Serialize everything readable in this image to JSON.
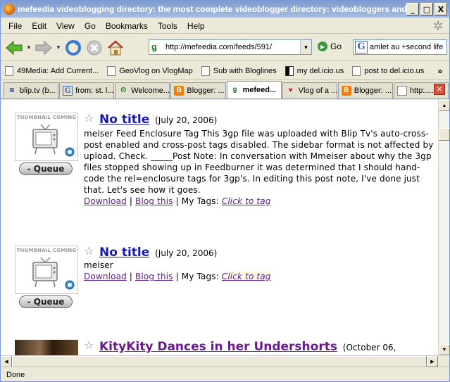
{
  "window": {
    "title": "mefeedia videoblogging directory: the most complete videoblogger directory: videobloggers and ...",
    "minimize": "_",
    "maximize": "□",
    "close": "X"
  },
  "menu": [
    {
      "label": "File",
      "key": "F"
    },
    {
      "label": "Edit",
      "key": "E"
    },
    {
      "label": "View",
      "key": "V"
    },
    {
      "label": "Go",
      "key": "G"
    },
    {
      "label": "Bookmarks",
      "key": "B"
    },
    {
      "label": "Tools",
      "key": "T"
    },
    {
      "label": "Help",
      "key": "H"
    }
  ],
  "navbar": {
    "url": "http://mefeedia.com/feeds/591/",
    "go_label": "Go",
    "search_value": "amlet au +second life"
  },
  "bookmarks": [
    {
      "label": "49Media: Add Current..."
    },
    {
      "label": "GeoVlog on VlogMap"
    },
    {
      "label": "Sub with Bloglines"
    },
    {
      "label": "my del.icio.us"
    },
    {
      "label": "post to del.icio.us"
    }
  ],
  "bookmarks_chevron": "»",
  "tabs": [
    {
      "label": "blip.tv (b...",
      "icon": "wifi-icon"
    },
    {
      "label": "from: st. l...",
      "icon": "google-icon"
    },
    {
      "label": "Welcome...",
      "icon": "tripadvisor-icon"
    },
    {
      "label": "Blogger: ...",
      "icon": "blogger-icon"
    },
    {
      "label": "mefeed...",
      "icon": "mefeedia-icon",
      "active": true
    },
    {
      "label": "Vlog of a ...",
      "icon": "heart-icon"
    },
    {
      "label": "Blogger: ...",
      "icon": "blogger-icon"
    },
    {
      "label": "http:....xml",
      "icon": "page-icon"
    }
  ],
  "posts": [
    {
      "thumb_label": "THUMBNAIL COMING",
      "queue_label": "- Queue",
      "title": "No title",
      "date": "(July 20, 2006)",
      "body": "meiser Feed Enclosure Tag This 3gp file was uploaded with Blip Tv's auto-cross-post enabled and cross-post tags disabled. The sidebar format is not affected by upload. Check. _____Post Note: In conversation with Mmeiser about why the 3gp files stopped showing up in Feedburner it was determined that I should hand-code the rel=enclosure tags for 3gp's. In editing this post note, I've done just that. Let's see how it goes.",
      "download": "Download",
      "blog_this": "Blog this",
      "my_tags": "My Tags:",
      "click_to_tag": "Click to tag"
    },
    {
      "thumb_label": "THUMBNAIL COMING",
      "queue_label": "- Queue",
      "title": "No title",
      "date": "(July 20, 2006)",
      "body": "meiser",
      "download": "Download",
      "blog_this": "Blog this",
      "my_tags": "My Tags:",
      "click_to_tag": "Click to tag"
    },
    {
      "title": "KityKity Dances in her Undershorts",
      "date": "(October 06,"
    }
  ],
  "status": "Done"
}
